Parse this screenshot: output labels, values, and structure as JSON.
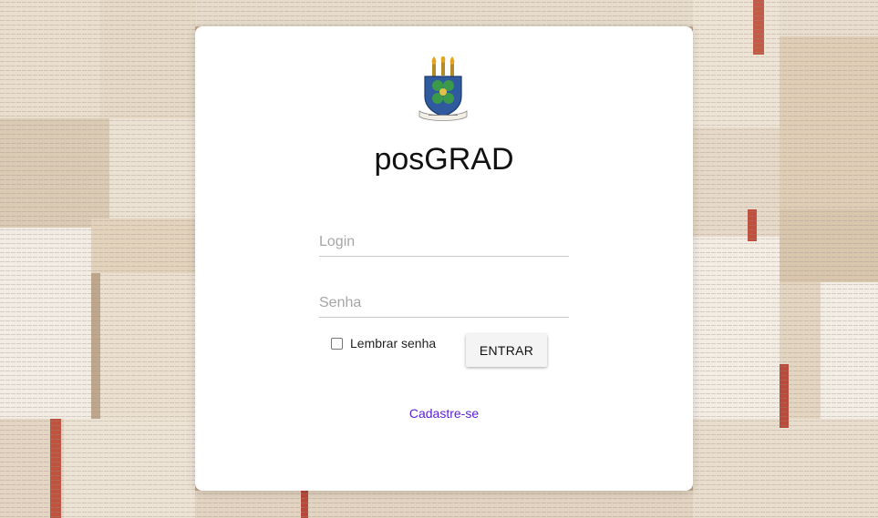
{
  "app": {
    "title": "posGRAD"
  },
  "form": {
    "login_placeholder": "Login",
    "password_placeholder": "Senha",
    "remember_label": "Lembrar senha",
    "remember_checked": false,
    "submit_label": "ENTRAR",
    "signup_label": "Cadastre-se"
  },
  "colors": {
    "card": "#ffffff",
    "link": "#5a1fd0",
    "button": "#f4f4f4"
  },
  "icons": {
    "logo": "university-crest-icon"
  }
}
